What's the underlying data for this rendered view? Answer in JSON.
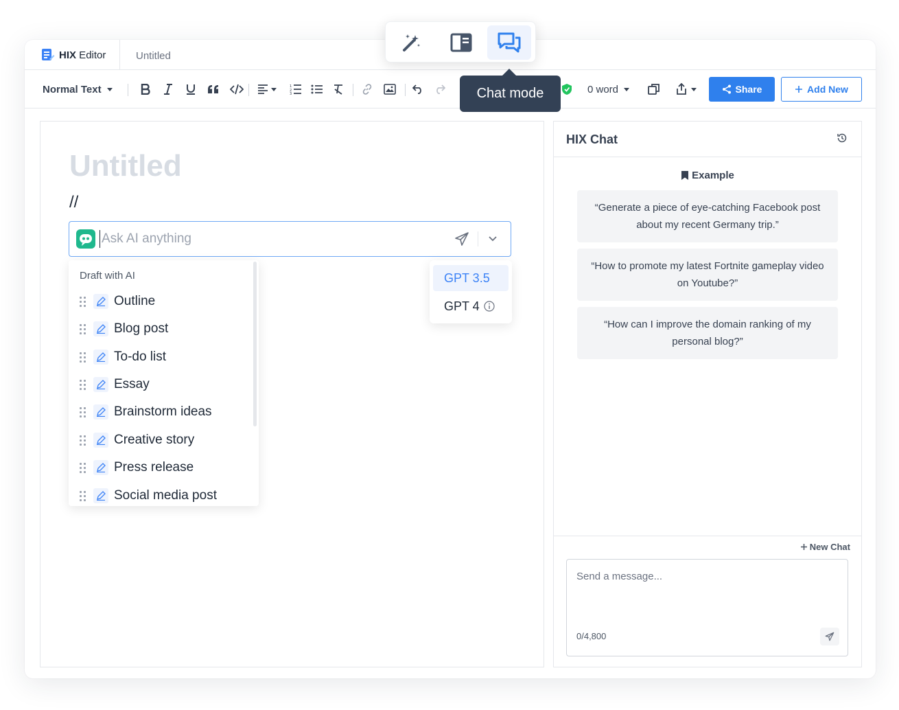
{
  "topbar": {
    "brand_bold": "HIX",
    "brand_rest": " Editor",
    "doc_tab": "Untitled"
  },
  "toolbar": {
    "text_style": "Normal Text",
    "word_count": "0 word",
    "share_label": "Share",
    "add_new_label": "Add New"
  },
  "mode_switch": {
    "tooltip": "Chat mode",
    "modes": [
      "magic-wand-icon",
      "split-layout-icon",
      "chat-icon"
    ],
    "active": "chat"
  },
  "editor": {
    "title_placeholder": "Untitled",
    "slash": "//",
    "ask_placeholder": "Ask AI anything",
    "draft_heading": "Draft with AI",
    "draft_items": [
      "Outline",
      "Blog post",
      "To-do list",
      "Essay",
      "Brainstorm ideas",
      "Creative story",
      "Press release",
      "Social media post"
    ],
    "models": [
      "GPT 3.5",
      "GPT 4"
    ],
    "selected_model": "GPT 3.5"
  },
  "chat": {
    "title": "HIX Chat",
    "example_heading": "Example",
    "examples": [
      "“Generate a piece of eye-catching Facebook post about my recent Germany trip.”",
      "“How to promote my latest Fortnite gameplay video on Youtube?”",
      "“How can I improve the domain ranking of my personal blog?”"
    ],
    "new_chat": "New Chat",
    "message_placeholder": "Send a message...",
    "char_count": "0/4,800"
  },
  "colors": {
    "accent": "#2f80ed",
    "tooltip_bg": "#334155",
    "bot_green": "#1fb88d",
    "shield_green": "#22c55e"
  }
}
